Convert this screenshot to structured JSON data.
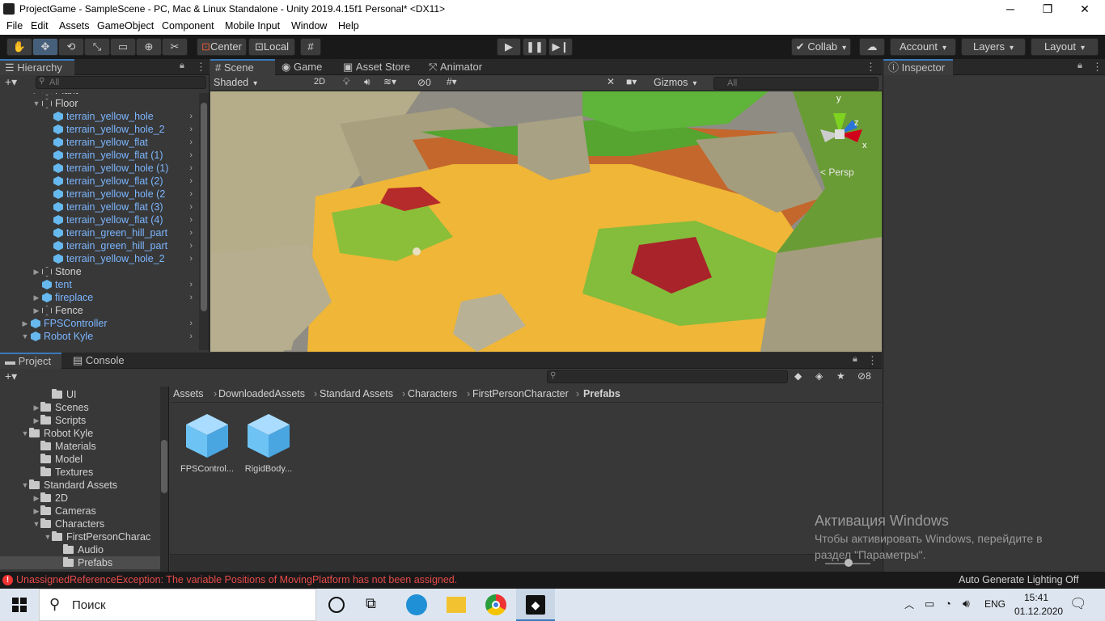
{
  "window": {
    "title": "ProjectGame - SampleScene - PC, Mac & Linux Standalone - Unity 2019.4.15f1 Personal* <DX11>",
    "minimize": "─",
    "maximize": "❐",
    "close": "✕"
  },
  "menu": [
    "File",
    "Edit",
    "Assets",
    "GameObject",
    "Component",
    "Mobile Input",
    "Window",
    "Help"
  ],
  "toolbar": {
    "pivot": "Center",
    "space": "Local",
    "collab": "Collab",
    "account": "Account",
    "layers": "Layers",
    "layout": "Layout"
  },
  "hierarchy": {
    "tab": "Hierarchy",
    "search_placeholder": "All",
    "rows": [
      {
        "name": "Plant",
        "blue": false,
        "depth": 2,
        "fold": "▶",
        "arrow": false
      },
      {
        "name": "Floor",
        "blue": false,
        "depth": 2,
        "fold": "▼",
        "arrow": false
      },
      {
        "name": "terrain_yellow_hole",
        "blue": true,
        "depth": 3,
        "fold": "",
        "arrow": true
      },
      {
        "name": "terrain_yellow_hole_2",
        "blue": true,
        "depth": 3,
        "fold": "",
        "arrow": true
      },
      {
        "name": "terrain_yellow_flat",
        "blue": true,
        "depth": 3,
        "fold": "",
        "arrow": true
      },
      {
        "name": "terrain_yellow_flat (1)",
        "blue": true,
        "depth": 3,
        "fold": "",
        "arrow": true
      },
      {
        "name": "terrain_yellow_hole (1)",
        "blue": true,
        "depth": 3,
        "fold": "",
        "arrow": true
      },
      {
        "name": "terrain_yellow_flat (2)",
        "blue": true,
        "depth": 3,
        "fold": "",
        "arrow": true
      },
      {
        "name": "terrain_yellow_hole (2",
        "blue": true,
        "depth": 3,
        "fold": "",
        "arrow": true
      },
      {
        "name": "terrain_yellow_flat (3)",
        "blue": true,
        "depth": 3,
        "fold": "",
        "arrow": true
      },
      {
        "name": "terrain_yellow_flat (4)",
        "blue": true,
        "depth": 3,
        "fold": "",
        "arrow": true
      },
      {
        "name": "terrain_green_hill_part",
        "blue": true,
        "depth": 3,
        "fold": "",
        "arrow": true
      },
      {
        "name": "terrain_green_hill_part",
        "blue": true,
        "depth": 3,
        "fold": "",
        "arrow": true
      },
      {
        "name": "terrain_yellow_hole_2",
        "blue": true,
        "depth": 3,
        "fold": "",
        "arrow": true
      },
      {
        "name": "Stone",
        "blue": false,
        "depth": 2,
        "fold": "▶",
        "arrow": false
      },
      {
        "name": "tent",
        "blue": true,
        "depth": 2,
        "fold": "",
        "arrow": true
      },
      {
        "name": "fireplace",
        "blue": true,
        "depth": 2,
        "fold": "▶",
        "arrow": true
      },
      {
        "name": "Fence",
        "blue": false,
        "depth": 2,
        "fold": "▶",
        "arrow": false
      },
      {
        "name": "FPSController",
        "blue": true,
        "depth": 1,
        "fold": "▶",
        "arrow": true
      },
      {
        "name": "Robot Kyle",
        "blue": true,
        "depth": 1,
        "fold": "▼",
        "arrow": true
      }
    ]
  },
  "scene": {
    "tabs": [
      "Scene",
      "Game",
      "Asset Store",
      "Animator"
    ],
    "shading": "Shaded",
    "mode2d": "2D",
    "hidden_count": "0",
    "gizmos": "Gizmos",
    "search_placeholder": "All",
    "persp": "< Persp",
    "axis_y": "y",
    "axis_z": "z",
    "axis_x": "x"
  },
  "inspector": {
    "tab": "Inspector"
  },
  "project": {
    "tabs": [
      "Project",
      "Console"
    ],
    "hidden_count": "8",
    "breadcrumb": [
      "Assets",
      "DownloadedAssets",
      "Standard Assets",
      "Characters",
      "FirstPersonCharacter",
      "Prefabs"
    ],
    "tree": [
      {
        "name": "UI",
        "depth": 2,
        "fold": ""
      },
      {
        "name": "Scenes",
        "depth": 1,
        "fold": "▶"
      },
      {
        "name": "Scripts",
        "depth": 1,
        "fold": "▶"
      },
      {
        "name": "Robot Kyle",
        "depth": 0,
        "fold": "▼"
      },
      {
        "name": "Materials",
        "depth": 1,
        "fold": ""
      },
      {
        "name": "Model",
        "depth": 1,
        "fold": ""
      },
      {
        "name": "Textures",
        "depth": 1,
        "fold": ""
      },
      {
        "name": "Standard Assets",
        "depth": 0,
        "fold": "▼"
      },
      {
        "name": "2D",
        "depth": 1,
        "fold": "▶"
      },
      {
        "name": "Cameras",
        "depth": 1,
        "fold": "▶"
      },
      {
        "name": "Characters",
        "depth": 1,
        "fold": "▼"
      },
      {
        "name": "FirstPersonCharac",
        "depth": 2,
        "fold": "▼"
      },
      {
        "name": "Audio",
        "depth": 3,
        "fold": ""
      },
      {
        "name": "Prefabs",
        "depth": 3,
        "fold": ""
      }
    ],
    "assets": [
      "FPSControl...",
      "RigidBody..."
    ]
  },
  "watermark": {
    "title": "Активация Windows",
    "line1": "Чтобы активировать Windows, перейдите в",
    "line2": "раздел \"Параметры\"."
  },
  "status": {
    "error": "UnassignedReferenceException: The variable Positions of MovingPlatform has not been assigned.",
    "lighting": "Auto Generate Lighting Off"
  },
  "taskbar": {
    "search": "Поиск",
    "lang": "ENG",
    "time": "15:41",
    "date": "01.12.2020"
  }
}
